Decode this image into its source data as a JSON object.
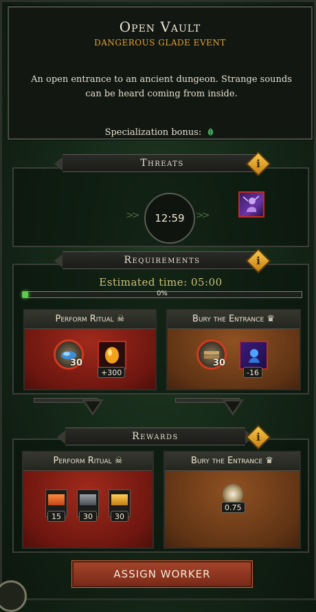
{
  "event": {
    "title": "Open Vault",
    "subtitle": "DANGEROUS GLADE EVENT",
    "description": "An open entrance to an ancient dungeon. Strange sounds can be heard coming from inside.",
    "specialization_label": "Specialization bonus:",
    "specialization_icon": "leaf-icon"
  },
  "threats": {
    "header": "Threats",
    "info_label": "i",
    "timer": "12:59",
    "threat_icon": "cursed-figure-icon"
  },
  "requirements": {
    "header": "Requirements",
    "info_label": "i",
    "estimated_time": "Estimated time: 05:00",
    "progress_label": "0%",
    "progress_value": 0.02,
    "options": [
      {
        "title": "Perform Ritual",
        "title_icon": "skull-icon",
        "resource_amount": "30",
        "effect_badge": "+300",
        "color": "#8f2418"
      },
      {
        "title": "Bury the Entrance",
        "title_icon": "crown-icon",
        "resource_amount": "30",
        "effect_badge": "-16",
        "color": "#7a431b"
      }
    ]
  },
  "rewards": {
    "header": "Rewards",
    "info_label": "i",
    "options": [
      {
        "title": "Perform Ritual",
        "title_icon": "skull-icon",
        "items": [
          {
            "icon": "copper-bar-icon",
            "amount": "15"
          },
          {
            "icon": "iron-ingot-icon",
            "amount": "30"
          },
          {
            "icon": "gold-bars-icon",
            "amount": "30"
          }
        ]
      },
      {
        "title": "Bury the Entrance",
        "title_icon": "crown-icon",
        "items": [
          {
            "icon": "glowing-orb-icon",
            "amount": "0.75"
          }
        ]
      }
    ]
  },
  "action": {
    "assign_label": "ASSIGN WORKER"
  }
}
